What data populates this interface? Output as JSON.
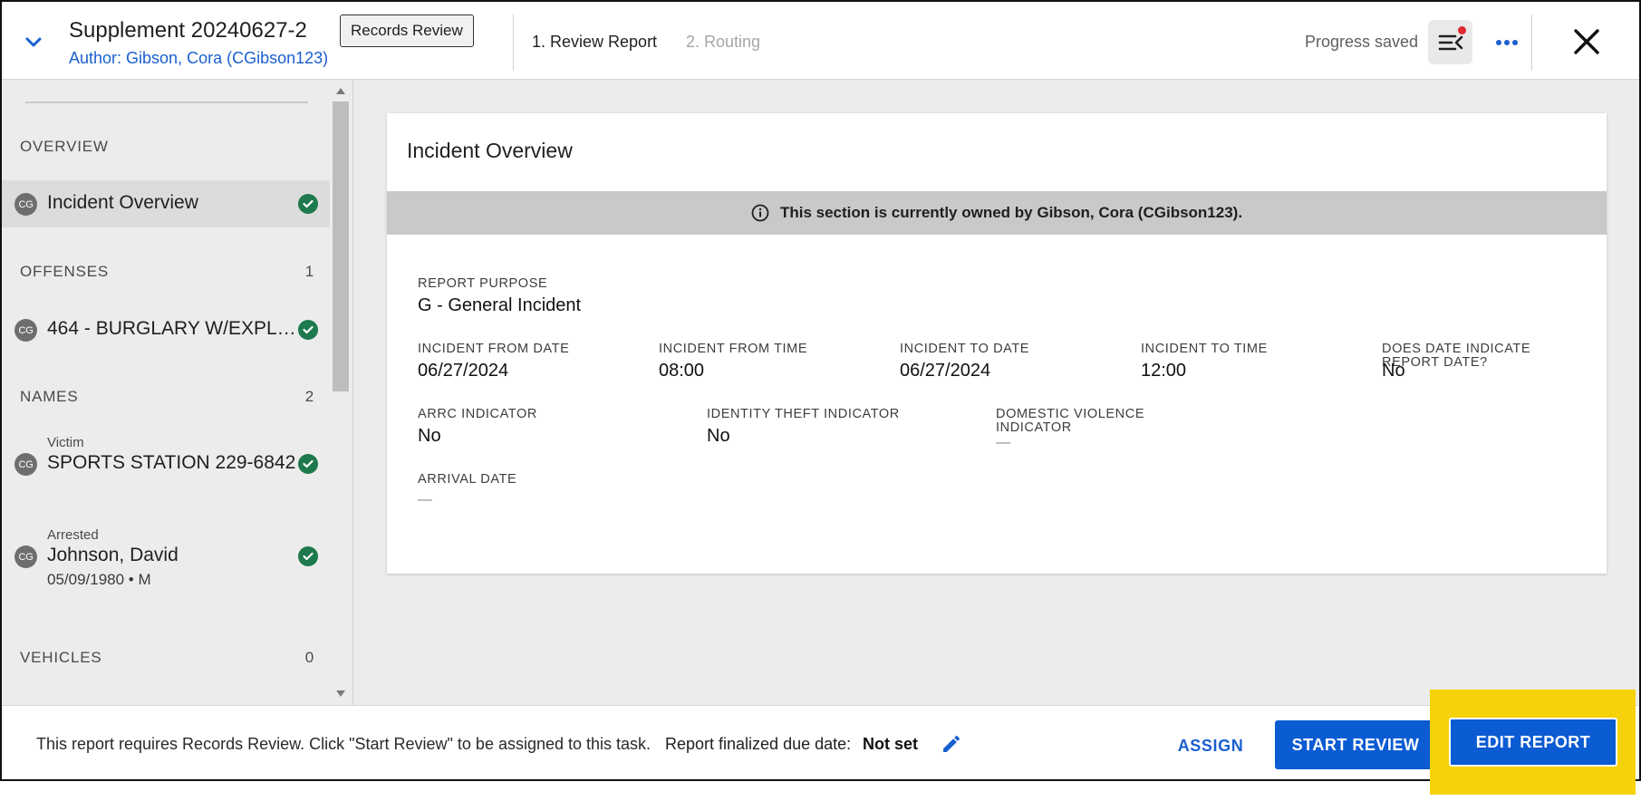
{
  "header": {
    "title": "Supplement 20240627-2",
    "author": "Author: Gibson, Cora (CGibson123)",
    "badge": "Records Review",
    "steps": [
      {
        "label": "1. Review Report",
        "state": "active"
      },
      {
        "label": "2. Routing",
        "state": "disabled"
      }
    ],
    "progress_status": "Progress saved",
    "icons": {
      "collapse": "chevron-down-icon",
      "activity": "activity-list-icon",
      "more": "more-horizontal-icon",
      "close": "close-icon"
    }
  },
  "sidebar": {
    "sections": [
      {
        "title": "OVERVIEW",
        "count": ""
      },
      {
        "title": "OFFENSES",
        "count": "1"
      },
      {
        "title": "NAMES",
        "count": "2"
      },
      {
        "title": "VEHICLES",
        "count": "0"
      }
    ],
    "items": [
      {
        "avatar": "CG",
        "label": "Incident Overview",
        "sub": "",
        "meta": "",
        "complete": true,
        "active": true
      },
      {
        "avatar": "CG",
        "label": "464 - BURGLARY W/EXPL…",
        "sub": "",
        "meta": "",
        "complete": true,
        "active": false
      },
      {
        "avatar": "CG",
        "label": "SPORTS STATION 229-6842",
        "sub": "Victim",
        "meta": "",
        "complete": true,
        "active": false
      },
      {
        "avatar": "CG",
        "label": "Johnson, David",
        "sub": "Arrested",
        "meta": "05/09/1980 • M",
        "complete": true,
        "active": false
      }
    ]
  },
  "card": {
    "title": "Incident Overview",
    "banner": "This section is currently owned by Gibson, Cora (CGibson123).",
    "fields": {
      "report_purpose": {
        "label": "REPORT PURPOSE",
        "value": "G - General Incident"
      },
      "incident_from_date": {
        "label": "INCIDENT FROM DATE",
        "value": "06/27/2024"
      },
      "incident_from_time": {
        "label": "INCIDENT FROM TIME",
        "value": "08:00"
      },
      "incident_to_date": {
        "label": "INCIDENT TO DATE",
        "value": "06/27/2024"
      },
      "incident_to_time": {
        "label": "INCIDENT TO TIME",
        "value": "12:00"
      },
      "date_indicate": {
        "label": "DOES DATE INDICATE REPORT DATE?",
        "value": "No"
      },
      "arrc_indicator": {
        "label": "ARRC INDICATOR",
        "value": "No"
      },
      "identity_theft": {
        "label": "IDENTITY THEFT INDICATOR",
        "value": "No"
      },
      "domestic_violence": {
        "label": "DOMESTIC VIOLENCE INDICATOR",
        "value": "—"
      },
      "arrival_date": {
        "label": "ARRIVAL DATE",
        "value": "—"
      }
    }
  },
  "footer": {
    "message": "This report requires Records Review. Click \"Start Review\" to be assigned to this task.",
    "due_label": "Report finalized due date:",
    "due_value": "Not set",
    "assign_label": "ASSIGN",
    "start_review_label": "START REVIEW",
    "edit_report_label": "EDIT REPORT"
  },
  "colors": {
    "primary": "#0b5bd3",
    "link": "#1a5fcf",
    "success": "#1e7a4d",
    "highlight": "#f5d20a",
    "notification": "#e0282e"
  }
}
